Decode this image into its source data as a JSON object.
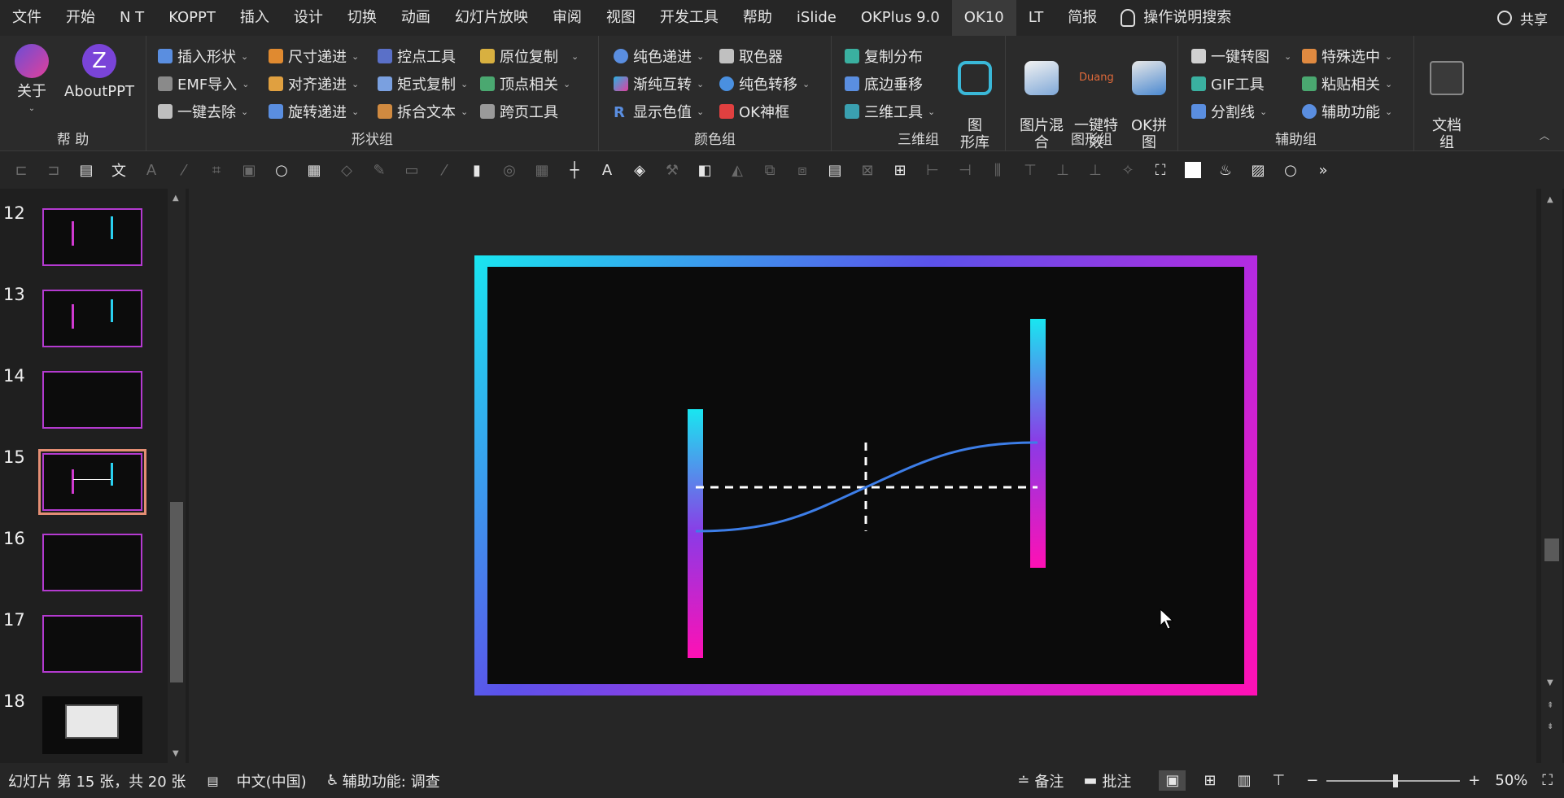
{
  "menu": {
    "tabs": [
      "文件",
      "开始",
      "N T",
      "KOPPT",
      "插入",
      "设计",
      "切换",
      "动画",
      "幻灯片放映",
      "审阅",
      "视图",
      "开发工具",
      "帮助",
      "iSlide",
      "OKPlus 9.0",
      "OK10",
      "LT",
      "简报"
    ],
    "active_tab": "OK10",
    "search": "操作说明搜索",
    "share": "共享"
  },
  "ribbon": {
    "help_group": {
      "label": "帮 助",
      "about": "关于",
      "aboutppt": "AboutPPT"
    },
    "shape_group": {
      "label": "形状组",
      "col1": [
        "插入形状",
        "EMF导入",
        "一键去除"
      ],
      "col2": [
        "尺寸递进",
        "对齐递进",
        "旋转递进"
      ],
      "col3": [
        "控点工具",
        "矩式复制",
        "拆合文本"
      ],
      "col4": [
        "原位复制",
        "顶点相关",
        "跨页工具"
      ]
    },
    "color_group": {
      "label": "颜色组",
      "col1": [
        "纯色递进",
        "渐纯互转",
        "显示色值"
      ],
      "col2": [
        "取色器",
        "纯色转移",
        "OK神框"
      ]
    },
    "three_d_group": {
      "label": "三维组",
      "col1": [
        "复制分布",
        "底边垂移",
        "三维工具"
      ],
      "big": "图\n形库"
    },
    "graphic_group": {
      "label": "图形组",
      "big1": "图片混\n合",
      "big2": "一键特\n效",
      "big3": "OK拼\n图",
      "duang": "Duang"
    },
    "assist_group": {
      "label": "辅助组",
      "col1": [
        "一键转图",
        "GIF工具",
        "分割线"
      ],
      "col2": [
        "特殊选中",
        "粘贴相关",
        "辅助功能"
      ],
      "big": "文档\n组"
    }
  },
  "slides": {
    "numbers": [
      "12",
      "13",
      "14",
      "15",
      "16",
      "17",
      "18"
    ],
    "selected": "15"
  },
  "status": {
    "slide_info": "幻灯片 第 15 张，共 20 张",
    "language": "中文(中国)",
    "accessibility": "辅助功能: 调查",
    "notes": "备注",
    "comments": "批注",
    "zoom": "50%"
  },
  "colors": {
    "accent_cyan": "#19e6f0",
    "accent_magenta": "#ff10b4",
    "curve_blue": "#3d7ee8"
  }
}
